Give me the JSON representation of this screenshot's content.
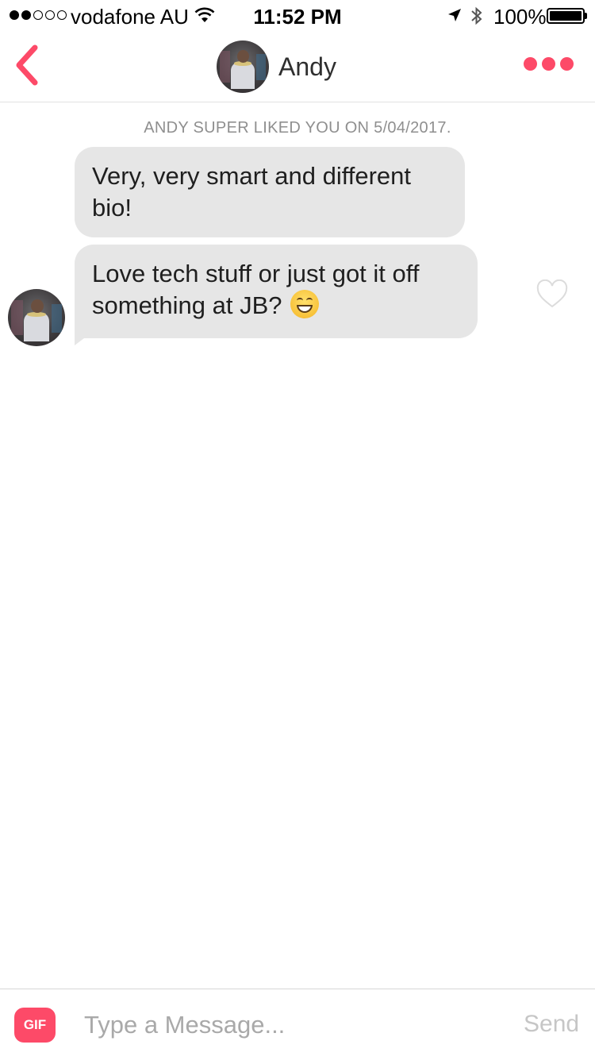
{
  "status_bar": {
    "carrier": "vodafone AU",
    "time": "11:52 PM",
    "battery": "100%",
    "signal_bars_filled": 2,
    "signal_bars_total": 5
  },
  "header": {
    "contact_name": "Andy",
    "back_icon": "chevron-left-icon",
    "more_icon": "more-dots-icon",
    "accent_color": "#fd4a68"
  },
  "chat": {
    "system_note": "ANDY SUPER LIKED YOU ON 5/04/2017.",
    "messages": [
      {
        "text": "Very, very smart and different bio!"
      },
      {
        "text": "Love tech stuff or just got it off something at JB?",
        "emoji": "grinning-face-icon"
      }
    ],
    "bubble_color": "#e6e6e6"
  },
  "composer": {
    "gif_label": "GIF",
    "placeholder": "Type a Message...",
    "value": "",
    "send_label": "Send"
  }
}
